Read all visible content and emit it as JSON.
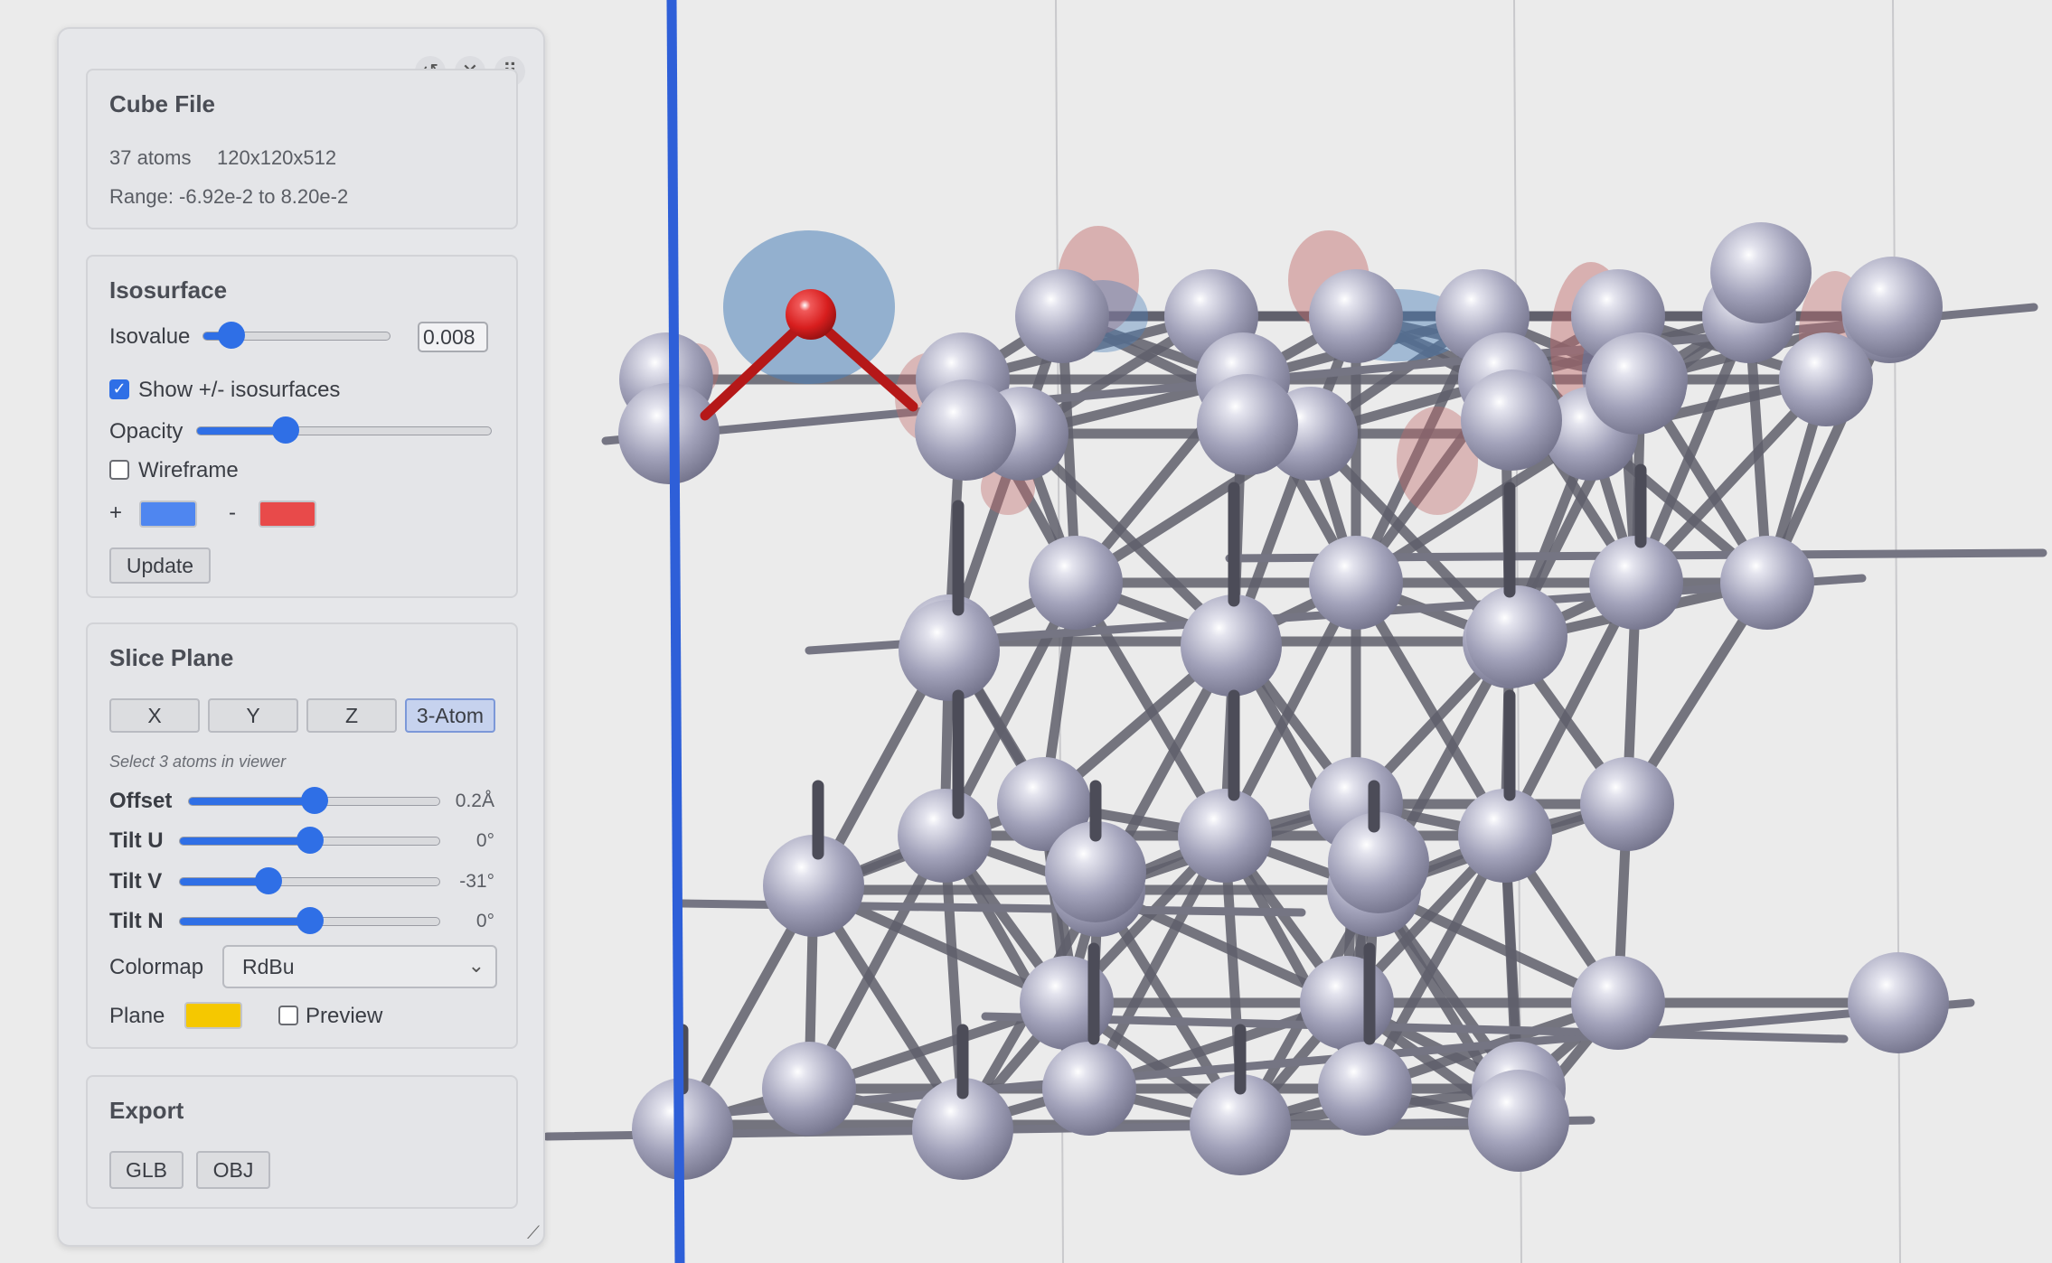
{
  "panel": {
    "tools": {
      "reset_icon": "↺",
      "close_icon": "✕",
      "drag_icon": "⠿"
    },
    "cube_file": {
      "title": "Cube File",
      "atoms": "37 atoms",
      "grid": "120x120x512",
      "range": "Range: -6.92e-2 to 8.20e-2"
    },
    "isosurface": {
      "title": "Isosurface",
      "isovalue_label": "Isovalue",
      "isovalue_value": "0.008",
      "isovalue_level": 0.15,
      "show_pm_label": "Show +/- isosurfaces",
      "show_pm_checked": true,
      "opacity_label": "Opacity",
      "opacity_level": 0.3,
      "wireframe_label": "Wireframe",
      "wireframe_checked": false,
      "plus_label": "+",
      "minus_label": "-",
      "plus_color": "#4f86f0",
      "minus_color": "#e84a4a",
      "update_label": "Update"
    },
    "slice_plane": {
      "title": "Slice Plane",
      "axis_buttons": [
        "X",
        "Y",
        "Z",
        "3-Atom"
      ],
      "active_axis": "3-Atom",
      "hint": "Select 3 atoms in viewer",
      "offset_label": "Offset",
      "offset_value": "0.2Å",
      "offset_level": 0.5,
      "tilt_u_label": "Tilt U",
      "tilt_u_value": "0°",
      "tilt_u_level": 0.5,
      "tilt_v_label": "Tilt V",
      "tilt_v_value": "-31°",
      "tilt_v_level": 0.34,
      "tilt_n_label": "Tilt N",
      "tilt_n_value": "0°",
      "tilt_n_level": 0.5,
      "colormap_label": "Colormap",
      "colormap_value": "RdBu",
      "plane_label": "Plane",
      "plane_color": "#f5c800",
      "preview_label": "Preview",
      "preview_checked": false
    },
    "export": {
      "title": "Export",
      "buttons": [
        "GLB",
        "OBJ"
      ]
    }
  },
  "viewer": {
    "background": "#ebebeb",
    "atom_color": "#a3a3bb",
    "bond_color": "#60606c",
    "highlight_atom_color": "#d81e1e",
    "positive_lobe_color": "#4a7fb8",
    "negative_lobe_color": "#c06868",
    "slice_plane_edge_color": "#2e5fd8"
  }
}
